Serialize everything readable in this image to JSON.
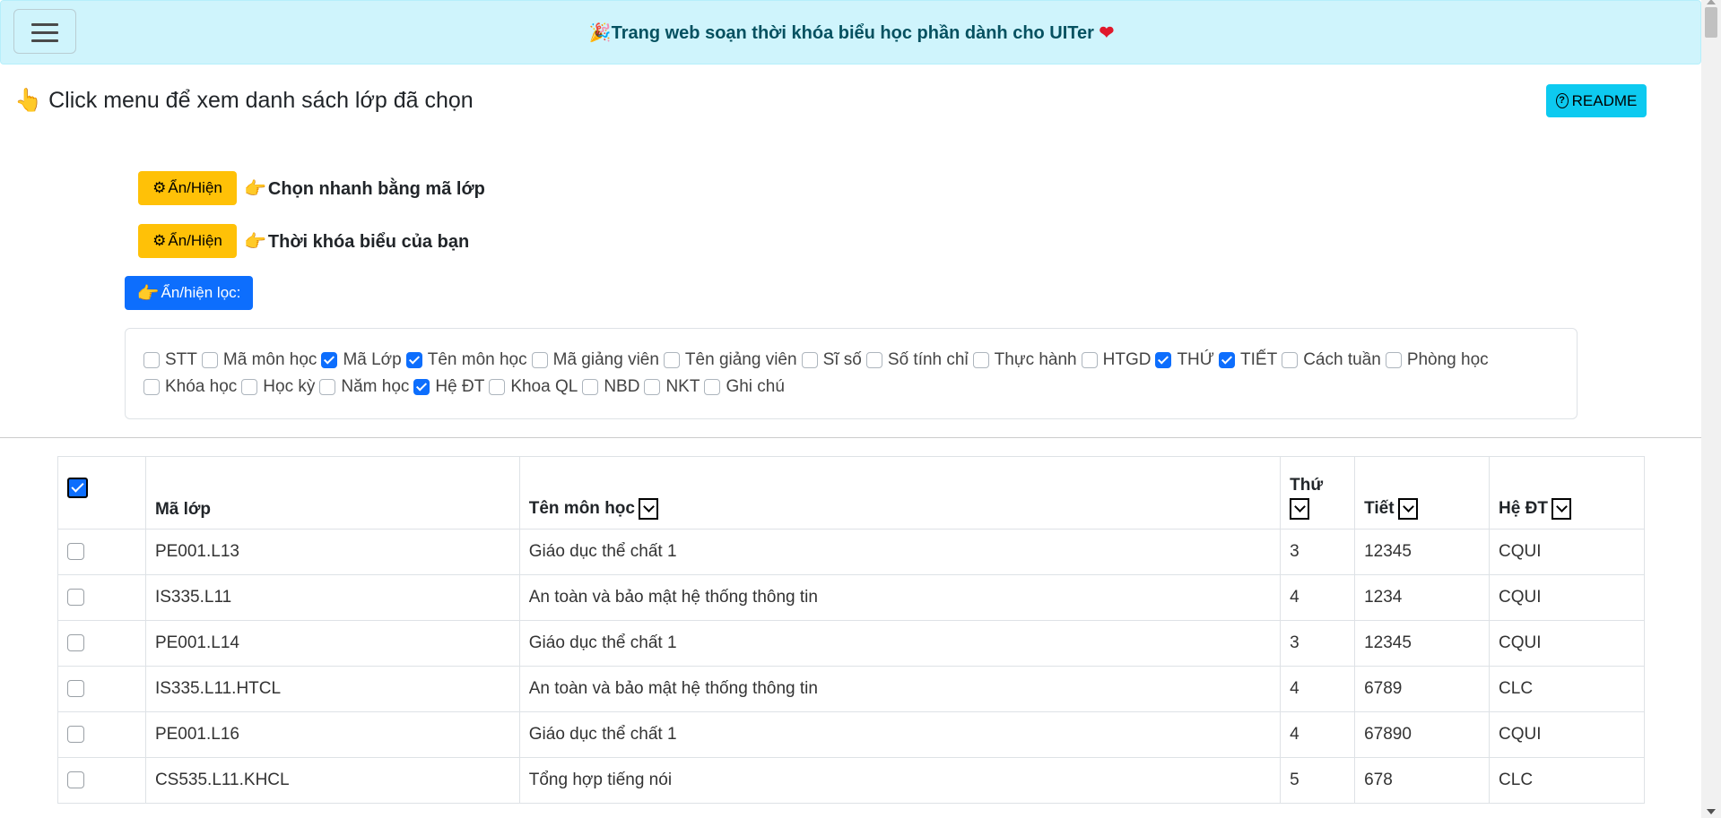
{
  "header": {
    "title_prefix_icon": "🎉",
    "title": "Trang web soạn thời khóa biểu học phần dành cho UITer",
    "heart": "❤"
  },
  "hint": {
    "icon": "👆",
    "text": "Click menu để xem danh sách lớp đã chọn"
  },
  "readme": {
    "label": "README"
  },
  "toggles": [
    {
      "button": "Ẩn/Hiện",
      "label": "Chọn nhanh bằng mã lớp"
    },
    {
      "button": "Ẩn/Hiện",
      "label": "Thời khóa biểu của bạn"
    }
  ],
  "filter_toggle": {
    "label": "Ẩn/hiện lọc:"
  },
  "filters": [
    {
      "label": "STT",
      "checked": false
    },
    {
      "label": "Mã môn học",
      "checked": false
    },
    {
      "label": "Mã Lớp",
      "checked": true
    },
    {
      "label": "Tên môn học",
      "checked": true
    },
    {
      "label": "Mã giảng viên",
      "checked": false
    },
    {
      "label": "Tên giảng viên",
      "checked": false
    },
    {
      "label": "Sĩ số",
      "checked": false
    },
    {
      "label": "Số tính chỉ",
      "checked": false
    },
    {
      "label": "Thực hành",
      "checked": false
    },
    {
      "label": "HTGD",
      "checked": false
    },
    {
      "label": "THỨ",
      "checked": true
    },
    {
      "label": "TIẾT",
      "checked": true
    },
    {
      "label": "Cách tuần",
      "checked": false
    },
    {
      "label": "Phòng học",
      "checked": false
    },
    {
      "label": "Khóa học",
      "checked": false
    },
    {
      "label": "Học kỳ",
      "checked": false
    },
    {
      "label": "Năm học",
      "checked": false
    },
    {
      "label": "Hệ ĐT",
      "checked": true
    },
    {
      "label": "Khoa QL",
      "checked": false
    },
    {
      "label": "NBD",
      "checked": false
    },
    {
      "label": "NKT",
      "checked": false
    },
    {
      "label": "Ghi chú",
      "checked": false
    }
  ],
  "table": {
    "columns": {
      "ma_lop": "Mã lớp",
      "ten_mon": "Tên môn học",
      "thu": "Thứ",
      "tiet": "Tiết",
      "he_dt": "Hệ ĐT"
    },
    "rows": [
      {
        "ma_lop": "PE001.L13",
        "ten_mon": "Giáo dục thể chất 1",
        "thu": "3",
        "tiet": "12345",
        "he_dt": "CQUI"
      },
      {
        "ma_lop": "IS335.L11",
        "ten_mon": "An toàn và bảo mật hệ thống thông tin",
        "thu": "4",
        "tiet": "1234",
        "he_dt": "CQUI"
      },
      {
        "ma_lop": "PE001.L14",
        "ten_mon": "Giáo dục thể chất 1",
        "thu": "3",
        "tiet": "12345",
        "he_dt": "CQUI"
      },
      {
        "ma_lop": "IS335.L11.HTCL",
        "ten_mon": "An toàn và bảo mật hệ thống thông tin",
        "thu": "4",
        "tiet": "6789",
        "he_dt": "CLC"
      },
      {
        "ma_lop": "PE001.L16",
        "ten_mon": "Giáo dục thể chất 1",
        "thu": "4",
        "tiet": "67890",
        "he_dt": "CQUI"
      },
      {
        "ma_lop": "CS535.L11.KHCL",
        "ten_mon": "Tổng hợp tiếng nói",
        "thu": "5",
        "tiet": "678",
        "he_dt": "CLC"
      }
    ]
  }
}
